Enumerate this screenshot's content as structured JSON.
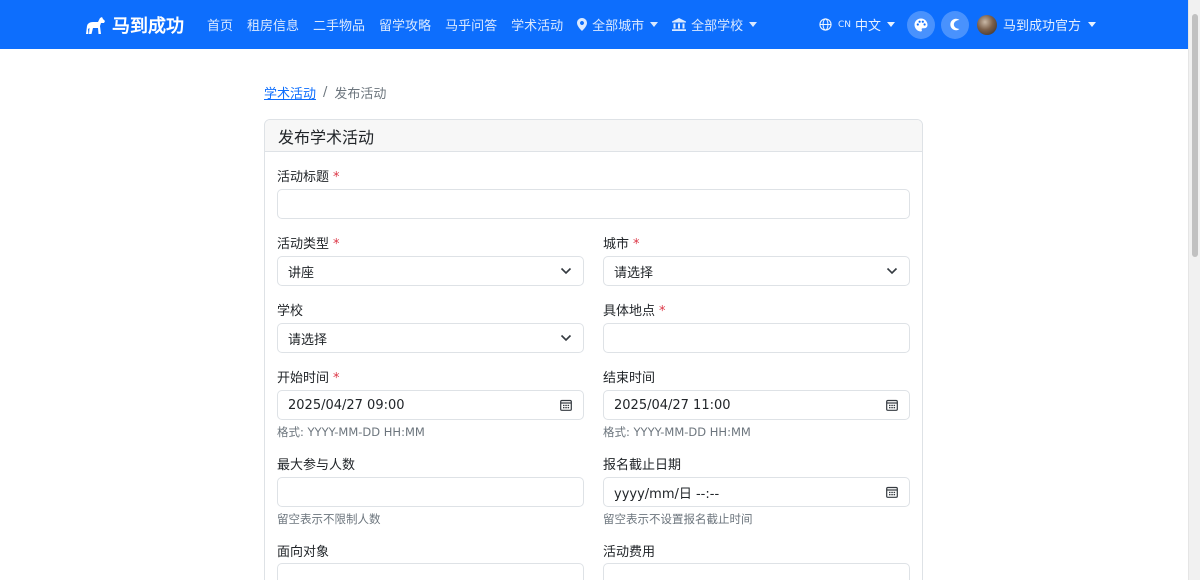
{
  "nav": {
    "brand": "马到成功",
    "links": [
      "首页",
      "租房信息",
      "二手物品",
      "留学攻略",
      "马乎问答",
      "学术活动"
    ],
    "city_dropdown": "全部城市",
    "school_dropdown": "全部学校",
    "lang_code": "CN",
    "lang_label": "中文",
    "user_name": "马到成功官方",
    "brand_color": "#0d6efd"
  },
  "breadcrumb": {
    "parent": "学术活动",
    "current": "发布活动"
  },
  "form": {
    "title": "发布学术活动",
    "required_mark": "*",
    "activity_title": {
      "label": "活动标题",
      "value": ""
    },
    "activity_type": {
      "label": "活动类型",
      "value": "讲座"
    },
    "city": {
      "label": "城市",
      "value": "请选择"
    },
    "school": {
      "label": "学校",
      "value": "请选择"
    },
    "location": {
      "label": "具体地点",
      "value": ""
    },
    "start_time": {
      "label": "开始时间",
      "value": "2025/04/27 09:00",
      "help": "格式: YYYY-MM-DD HH:MM"
    },
    "end_time": {
      "label": "结束时间",
      "value": "2025/04/27 11:00",
      "help": "格式: YYYY-MM-DD HH:MM"
    },
    "max_participants": {
      "label": "最大参与人数",
      "value": "",
      "help": "留空表示不限制人数"
    },
    "signup_deadline": {
      "label": "报名截止日期",
      "value": "yyyy/mm/日 --:--",
      "help": "留空表示不设置报名截止时间"
    },
    "audience": {
      "label": "面向对象",
      "value": ""
    },
    "fee": {
      "label": "活动费用",
      "value": ""
    }
  },
  "icons": [
    "horse-icon",
    "map-pin-icon",
    "bank-icon",
    "globe-icon",
    "palette-icon",
    "moon-icon",
    "chevron-down-icon",
    "calendar-icon"
  ]
}
